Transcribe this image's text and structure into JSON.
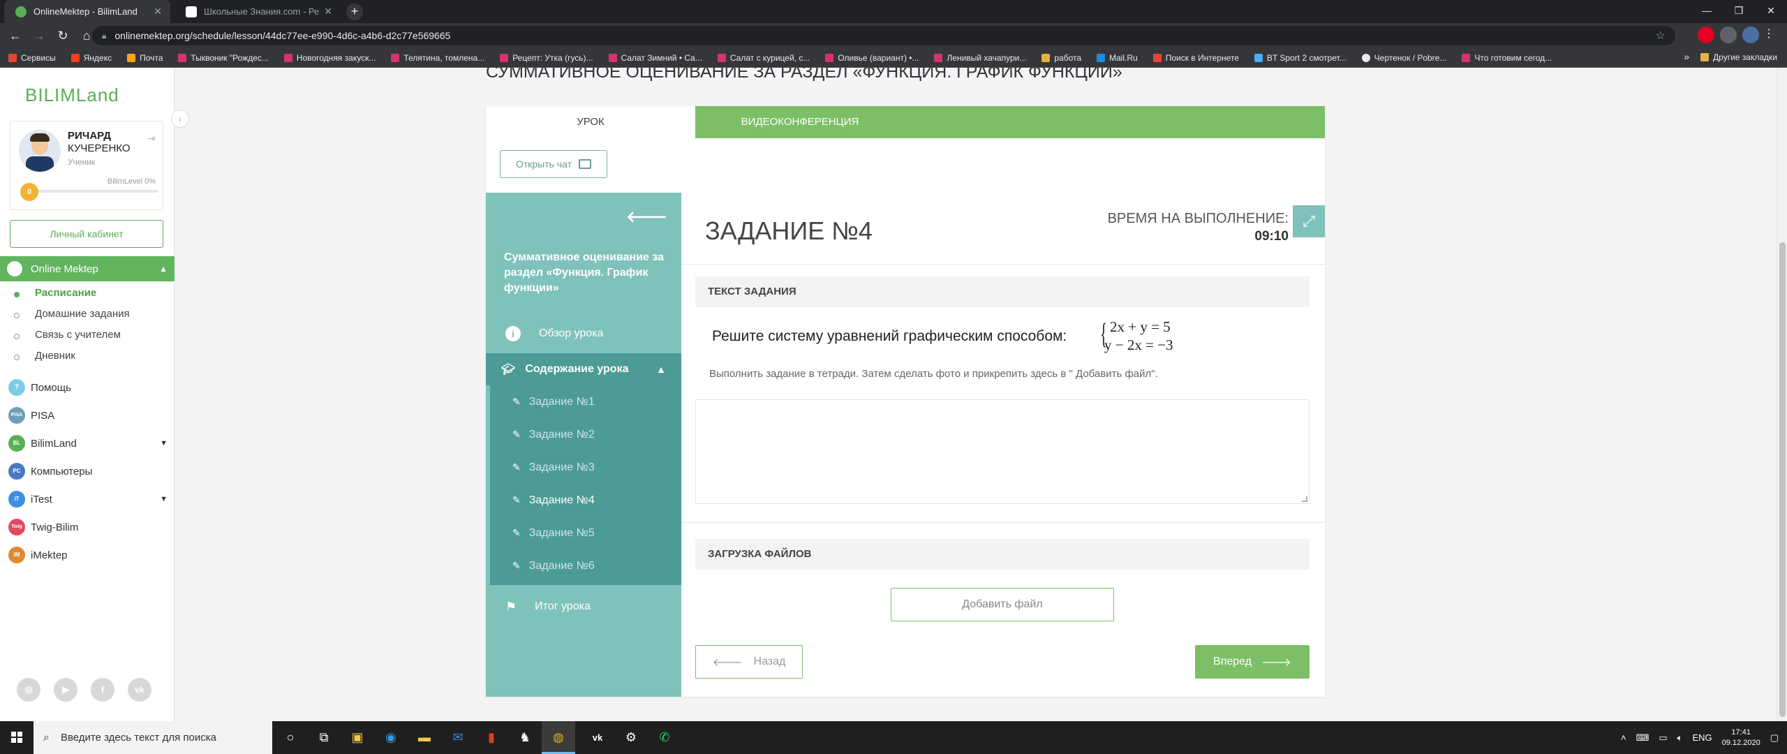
{
  "browser": {
    "tabs": [
      {
        "title": "OnlineMektep - BilimLand",
        "active": true
      },
      {
        "title": "Школьные Знания.com - Решаю",
        "active": false
      }
    ],
    "url": "onlinemektep.org/schedule/lesson/44dc77ee-e990-4d6c-a4b6-d2c77e569665",
    "bookmarks": [
      "Сервисы",
      "Яндекс",
      "Почта",
      "Тыквоник \"Рождес...",
      "Новогодняя закуск...",
      "Телятина, томлена...",
      "Рецепт: Утка (гусь)...",
      "Салат Зимний • Са...",
      "Салат с курицей, с...",
      "Оливье (вариант) •...",
      "Ленивый хачапури...",
      "работа",
      "Mail.Ru",
      "Поиск в Интернете",
      "BT Sport 2 смотрет...",
      "Чертенок / Pobre...",
      "Что готовим сегод..."
    ],
    "other_bookmarks": "Другие закладки"
  },
  "sidebar": {
    "logo": "BILIMLand",
    "profile": {
      "first_name": "РИЧАРД",
      "last_name": "КУЧЕРЕНКО",
      "role": "Ученик",
      "level_label": "BilimLevel 0%",
      "level_value": "0",
      "level_progress_percent": 5
    },
    "cabinet_button": "Личный кабинет",
    "active_section": "Online Mektep",
    "submenu": [
      "Расписание",
      "Домашние задания",
      "Связь с учителем",
      "Дневник"
    ],
    "items": [
      "Помощь",
      "PISA",
      "BilimLand",
      "Компьютеры",
      "iTest",
      "Twig-Bilim",
      "iMektep"
    ],
    "icon_badges": [
      "?",
      "PISA",
      "BL",
      "PC",
      "iT",
      "Twig",
      "iM"
    ],
    "socials": [
      "instagram-icon",
      "youtube-icon",
      "facebook-icon",
      "vk-icon"
    ],
    "social_glyphs": [
      "◎",
      "▶",
      "f",
      "vk"
    ]
  },
  "page": {
    "heading": "СУММАТИВНОЕ ОЦЕНИВАНИЕ ЗА РАЗДЕЛ «ФУНКЦИЯ. ГРАФИК ФУНКЦИИ»",
    "tabs": {
      "lesson": "УРОК",
      "video": "ВИДЕОКОНФЕРЕНЦИЯ"
    },
    "chat_button": "Открыть чат"
  },
  "lesson_nav": {
    "title": "Суммативное оценивание за раздел «Функция. График функции»",
    "overview": "Обзор урока",
    "content": "Содержание урока",
    "tasks": [
      "Задание №1",
      "Задание №2",
      "Задание №3",
      "Задание №4",
      "Задание №5",
      "Задание №6"
    ],
    "current_task_index": 3,
    "result": "Итог урока"
  },
  "task": {
    "title": "ЗАДАНИЕ №4",
    "timer_label": "ВРЕМЯ НА ВЫПОЛНЕНИЕ:",
    "timer_value": "09:10",
    "text_section": "ТЕКСТ ЗАДАНИЯ",
    "question": "Решите систему уравнений графическим способом:",
    "equation_1": "2x + y = 5",
    "equation_2": "y − 2x = −3",
    "instruction": "Выполнить задание в тетради. Затем сделать фото и прикрепить здесь в \" Добавить файл\".",
    "answer_value": "",
    "upload_section": "ЗАГРУЗКА ФАЙЛОВ",
    "add_file_button": "Добавить файл",
    "back_button": "Назад",
    "next_button": "Вперед"
  },
  "taskbar": {
    "search_placeholder": "Введите здесь текст для поиска",
    "language": "ENG",
    "time": "17:41",
    "date": "09.12.2020"
  },
  "colors": {
    "brand_green": "#7cbf66",
    "teal_nav": "#7fc1bb",
    "teal_dark": "#4c9b95",
    "level_orange": "#f2b233"
  }
}
